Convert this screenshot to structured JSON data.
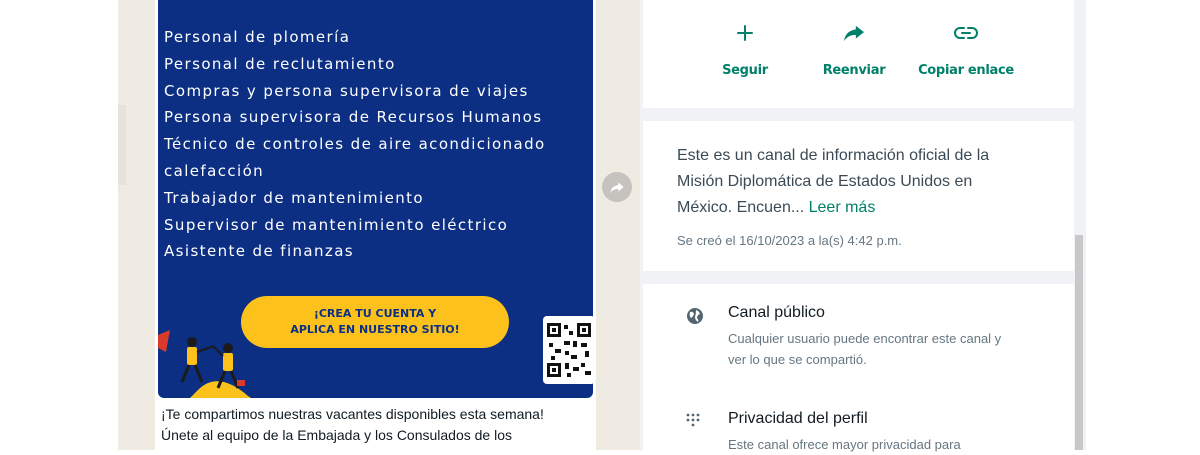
{
  "message": {
    "flyer": {
      "positions": [
        "Personal de plomería",
        "Personal de reclutamiento",
        "Compras y persona supervisora de viajes",
        "Persona supervisora de Recursos Humanos",
        "Técnico de controles de aire acondicionado",
        "calefacción",
        "Trabajador de mantenimiento",
        "Supervisor de mantenimiento eléctrico",
        "Asistente de finanzas"
      ],
      "cta_line1": "¡CREA TU CUENTA Y",
      "cta_line2": "APLICA EN NUESTRO SITIO!"
    },
    "caption_line1": "¡Te compartimos nuestras vacantes disponibles esta semana!",
    "caption_line2": "Únete al equipo de la Embajada y los Consulados de los"
  },
  "actions": {
    "follow": "Seguir",
    "forward": "Reenviar",
    "copy_link": "Copiar enlace"
  },
  "description": {
    "text": "Este es un canal de información oficial de la Misión Diplomática de Estados Unidos en México. Encuen...",
    "read_more": "Leer más",
    "created": "Se creó el 16/10/2023 a la(s) 4:42 p.m."
  },
  "info": {
    "public_title": "Canal público",
    "public_sub": "Cualquier usuario puede encontrar este canal y ver lo que se compartió.",
    "privacy_title": "Privacidad del perfil",
    "privacy_sub": "Este canal ofrece mayor privacidad para"
  },
  "colors": {
    "accent": "#008069",
    "flyer_bg": "#0c2f84",
    "cta_bg": "#fcc21b"
  },
  "icons": {
    "follow": "plus-icon",
    "forward": "share-arrow-icon",
    "copy_link": "link-icon",
    "public": "globe-icon",
    "privacy": "dots-grid-icon"
  }
}
